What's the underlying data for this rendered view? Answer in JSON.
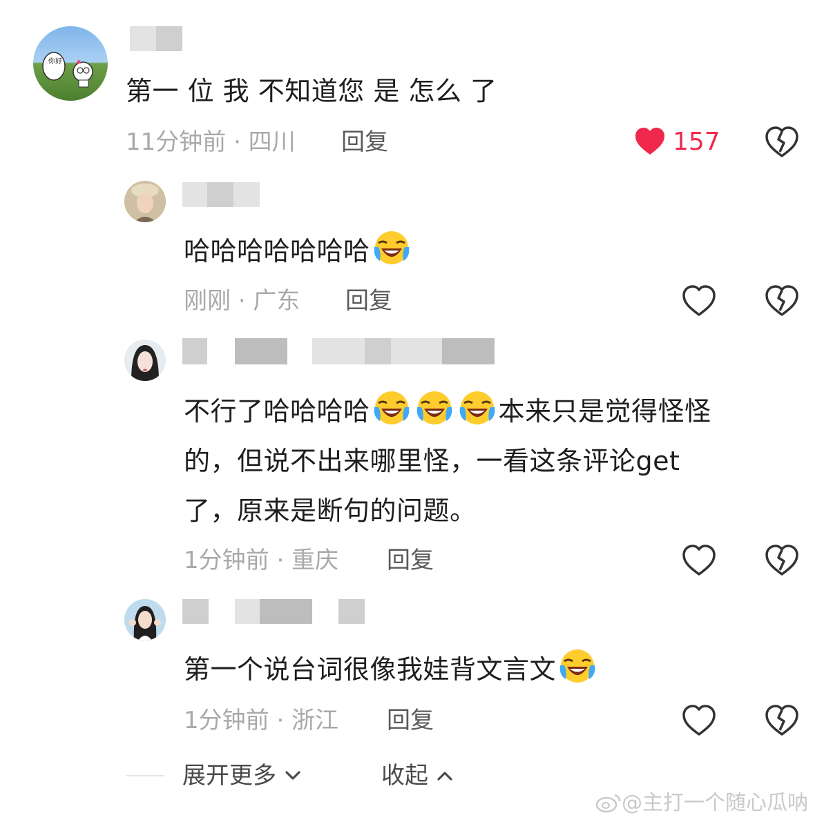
{
  "comments": [
    {
      "text": "第一 位 我 不知道您 是 怎么 了",
      "time_location": "11分钟前 · 四川",
      "reply_label": "回复",
      "likes": "157",
      "liked": true
    },
    {
      "text": "哈哈哈哈哈哈哈",
      "time_location": "刚刚 · 广东",
      "reply_label": "回复"
    },
    {
      "text_line1": "不行了哈哈哈哈",
      "text_line1b": "本来只是觉得怪怪",
      "text_line2": "的，但说不出来哪里怪，一看这条评论get",
      "text_line3": "了，原来是断句的问题。",
      "time_location": "1分钟前 · 重庆",
      "reply_label": "回复"
    },
    {
      "text": "第一个说台词很像我娃背文言文",
      "time_location": "1分钟前 · 浙江",
      "reply_label": "回复"
    }
  ],
  "footer": {
    "expand_label": "展开更多",
    "collapse_label": "收起"
  },
  "watermark": "@主打一个随心瓜呐",
  "avatar_sign": "你好",
  "colors": {
    "like_red": "#f0294c",
    "meta_gray": "#a9a9a9"
  }
}
